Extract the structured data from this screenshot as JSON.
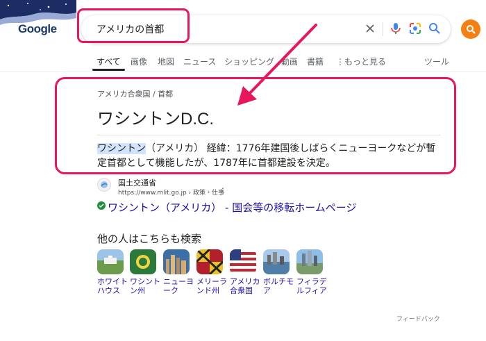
{
  "logo": "Google",
  "search": {
    "query": "アメリカの首都"
  },
  "tabs": [
    {
      "label": "すべて",
      "active": true
    },
    {
      "label": "画像"
    },
    {
      "label": "地図"
    },
    {
      "label": "ニュース"
    },
    {
      "label": "ショッピング"
    },
    {
      "label": "動画"
    },
    {
      "label": "書籍"
    },
    {
      "label": "もっと見る"
    },
    {
      "label": "ツール"
    }
  ],
  "answer": {
    "breadcrumb_part1": "アメリカ合衆国",
    "breadcrumb_sep": "/",
    "breadcrumb_part2": "首都",
    "title": "ワシントンD.C.",
    "snippet_highlight": "ワシントン",
    "snippet_rest": "（アメリカ） 経緯：1776年建国後しばらくニューヨークなどが暫定首都として機能したが、1787年に首都建設を決定。"
  },
  "source": {
    "name": "国土交通省",
    "url": "https://www.mlit.go.jp › 政策・仕事",
    "link_text": "ワシントン（アメリカ） - 国会等の移転ホームページ"
  },
  "related": {
    "heading": "他の人はこちらも検索",
    "items": [
      {
        "label": "ホワイトハウス"
      },
      {
        "label": "ワシントン州"
      },
      {
        "label": "ニューヨーク"
      },
      {
        "label": "メリーランド州"
      },
      {
        "label": "アメリカ合衆国"
      },
      {
        "label": "ボルチモア"
      },
      {
        "label": "フィラデルフィア"
      }
    ]
  },
  "feedback": "フィードバック",
  "colors": {
    "annotation": "#e8175d",
    "link": "#1a0dab",
    "accent_orange": "#f47f12"
  }
}
